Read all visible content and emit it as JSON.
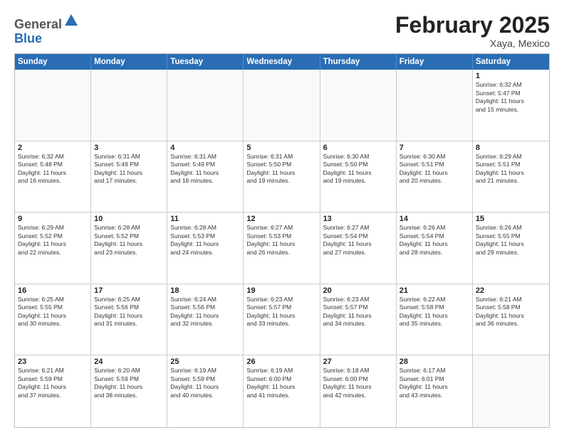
{
  "header": {
    "logo_general": "General",
    "logo_blue": "Blue",
    "month_title": "February 2025",
    "location": "Xaya, Mexico"
  },
  "weekdays": [
    "Sunday",
    "Monday",
    "Tuesday",
    "Wednesday",
    "Thursday",
    "Friday",
    "Saturday"
  ],
  "weeks": [
    [
      {
        "day": "",
        "info": ""
      },
      {
        "day": "",
        "info": ""
      },
      {
        "day": "",
        "info": ""
      },
      {
        "day": "",
        "info": ""
      },
      {
        "day": "",
        "info": ""
      },
      {
        "day": "",
        "info": ""
      },
      {
        "day": "1",
        "info": "Sunrise: 6:32 AM\nSunset: 5:47 PM\nDaylight: 11 hours\nand 15 minutes."
      }
    ],
    [
      {
        "day": "2",
        "info": "Sunrise: 6:32 AM\nSunset: 5:48 PM\nDaylight: 11 hours\nand 16 minutes."
      },
      {
        "day": "3",
        "info": "Sunrise: 6:31 AM\nSunset: 5:49 PM\nDaylight: 11 hours\nand 17 minutes."
      },
      {
        "day": "4",
        "info": "Sunrise: 6:31 AM\nSunset: 5:49 PM\nDaylight: 11 hours\nand 18 minutes."
      },
      {
        "day": "5",
        "info": "Sunrise: 6:31 AM\nSunset: 5:50 PM\nDaylight: 11 hours\nand 19 minutes."
      },
      {
        "day": "6",
        "info": "Sunrise: 6:30 AM\nSunset: 5:50 PM\nDaylight: 11 hours\nand 19 minutes."
      },
      {
        "day": "7",
        "info": "Sunrise: 6:30 AM\nSunset: 5:51 PM\nDaylight: 11 hours\nand 20 minutes."
      },
      {
        "day": "8",
        "info": "Sunrise: 6:29 AM\nSunset: 5:51 PM\nDaylight: 11 hours\nand 21 minutes."
      }
    ],
    [
      {
        "day": "9",
        "info": "Sunrise: 6:29 AM\nSunset: 5:52 PM\nDaylight: 11 hours\nand 22 minutes."
      },
      {
        "day": "10",
        "info": "Sunrise: 6:28 AM\nSunset: 5:52 PM\nDaylight: 11 hours\nand 23 minutes."
      },
      {
        "day": "11",
        "info": "Sunrise: 6:28 AM\nSunset: 5:53 PM\nDaylight: 11 hours\nand 24 minutes."
      },
      {
        "day": "12",
        "info": "Sunrise: 6:27 AM\nSunset: 5:53 PM\nDaylight: 11 hours\nand 26 minutes."
      },
      {
        "day": "13",
        "info": "Sunrise: 6:27 AM\nSunset: 5:54 PM\nDaylight: 11 hours\nand 27 minutes."
      },
      {
        "day": "14",
        "info": "Sunrise: 6:26 AM\nSunset: 5:54 PM\nDaylight: 11 hours\nand 28 minutes."
      },
      {
        "day": "15",
        "info": "Sunrise: 6:26 AM\nSunset: 5:55 PM\nDaylight: 11 hours\nand 29 minutes."
      }
    ],
    [
      {
        "day": "16",
        "info": "Sunrise: 6:25 AM\nSunset: 5:55 PM\nDaylight: 11 hours\nand 30 minutes."
      },
      {
        "day": "17",
        "info": "Sunrise: 6:25 AM\nSunset: 5:56 PM\nDaylight: 11 hours\nand 31 minutes."
      },
      {
        "day": "18",
        "info": "Sunrise: 6:24 AM\nSunset: 5:56 PM\nDaylight: 11 hours\nand 32 minutes."
      },
      {
        "day": "19",
        "info": "Sunrise: 6:23 AM\nSunset: 5:57 PM\nDaylight: 11 hours\nand 33 minutes."
      },
      {
        "day": "20",
        "info": "Sunrise: 6:23 AM\nSunset: 5:57 PM\nDaylight: 11 hours\nand 34 minutes."
      },
      {
        "day": "21",
        "info": "Sunrise: 6:22 AM\nSunset: 5:58 PM\nDaylight: 11 hours\nand 35 minutes."
      },
      {
        "day": "22",
        "info": "Sunrise: 6:21 AM\nSunset: 5:58 PM\nDaylight: 11 hours\nand 36 minutes."
      }
    ],
    [
      {
        "day": "23",
        "info": "Sunrise: 6:21 AM\nSunset: 5:59 PM\nDaylight: 11 hours\nand 37 minutes."
      },
      {
        "day": "24",
        "info": "Sunrise: 6:20 AM\nSunset: 5:59 PM\nDaylight: 11 hours\nand 38 minutes."
      },
      {
        "day": "25",
        "info": "Sunrise: 6:19 AM\nSunset: 5:59 PM\nDaylight: 11 hours\nand 40 minutes."
      },
      {
        "day": "26",
        "info": "Sunrise: 6:19 AM\nSunset: 6:00 PM\nDaylight: 11 hours\nand 41 minutes."
      },
      {
        "day": "27",
        "info": "Sunrise: 6:18 AM\nSunset: 6:00 PM\nDaylight: 11 hours\nand 42 minutes."
      },
      {
        "day": "28",
        "info": "Sunrise: 6:17 AM\nSunset: 6:01 PM\nDaylight: 11 hours\nand 43 minutes."
      },
      {
        "day": "",
        "info": ""
      }
    ]
  ]
}
